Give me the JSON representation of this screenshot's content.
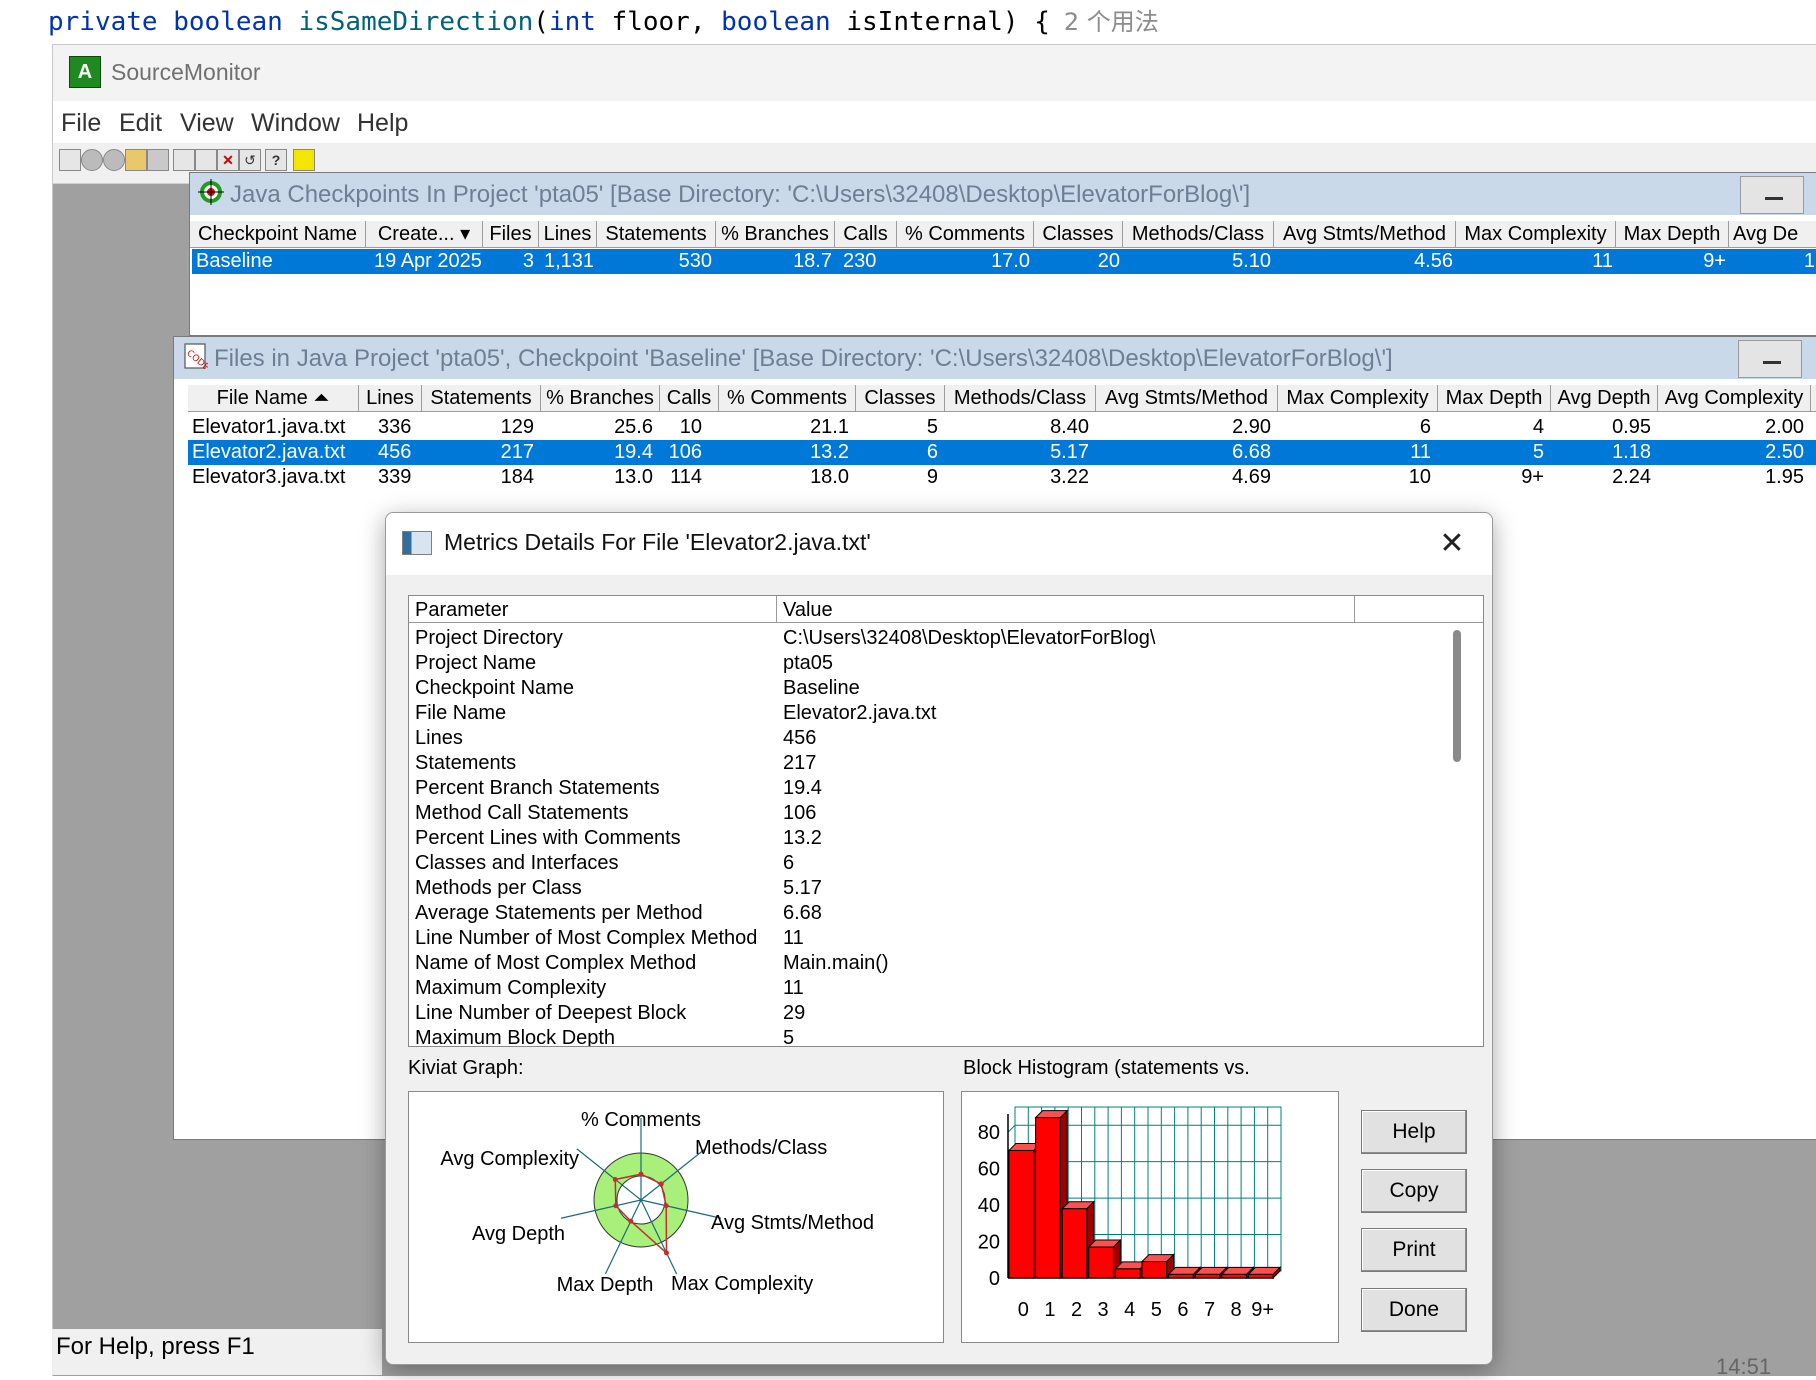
{
  "code": {
    "kw1": "private",
    "kw2": "boolean",
    "method": "isSameDirection",
    "params_open": "(",
    "kw3": "int",
    "param1": " floor, ",
    "kw4": "boolean",
    "param2": " isInternal) {",
    "usage_hint": "2 个用法"
  },
  "app": {
    "title": "SourceMonitor",
    "logo_glyph": "A",
    "menu": [
      "File",
      "Edit",
      "View",
      "Window",
      "Help"
    ],
    "status_text": "For Help, press F1",
    "clock": "14:51"
  },
  "checkpoints_window": {
    "title": "Java Checkpoints In Project 'pta05'  [Base Directory: 'C:\\Users\\32408\\Desktop\\ElevatorForBlog\\']",
    "columns": [
      "Checkpoint Name",
      "Create... ▾",
      "Files",
      "Lines",
      "Statements",
      "% Branches",
      "Calls",
      "% Comments",
      "Classes",
      "Methods/Class",
      "Avg Stmts/Method",
      "Max Complexity",
      "Max Depth",
      "Avg De"
    ],
    "rows": [
      [
        "Baseline",
        "19 Apr 2025",
        "3",
        "1,131",
        "530",
        "18.7",
        "230",
        "17.0",
        "20",
        "5.10",
        "4.56",
        "11",
        "9+",
        "1"
      ]
    ]
  },
  "files_window": {
    "title": "Files in Java Project 'pta05', Checkpoint 'Baseline'  [Base Directory: 'C:\\Users\\32408\\Desktop\\ElevatorForBlog\\']",
    "columns": [
      "File Name ⏶",
      "Lines",
      "Statements",
      "% Branches",
      "Calls",
      "% Comments",
      "Classes",
      "Methods/Class",
      "Avg Stmts/Method",
      "Max Complexity",
      "Max Depth",
      "Avg Depth",
      "Avg Complexity"
    ],
    "rows": [
      [
        "Elevator1.java.txt",
        "336",
        "129",
        "25.6",
        "10",
        "21.1",
        "5",
        "8.40",
        "2.90",
        "6",
        "4",
        "0.95",
        "2.00"
      ],
      [
        "Elevator2.java.txt",
        "456",
        "217",
        "19.4",
        "106",
        "13.2",
        "6",
        "5.17",
        "6.68",
        "11",
        "5",
        "1.18",
        "2.50"
      ],
      [
        "Elevator3.java.txt",
        "339",
        "184",
        "13.0",
        "114",
        "18.0",
        "9",
        "3.22",
        "4.69",
        "10",
        "9+",
        "2.24",
        "1.95"
      ]
    ],
    "selected_row": 1
  },
  "dialog": {
    "title": "Metrics Details For File 'Elevator2.java.txt'",
    "close_glyph": "✕",
    "param_header": "Parameter",
    "value_header": "Value",
    "params": [
      {
        "name": "Project Directory",
        "value": "C:\\Users\\32408\\Desktop\\ElevatorForBlog\\"
      },
      {
        "name": "Project Name",
        "value": "pta05"
      },
      {
        "name": "Checkpoint Name",
        "value": "Baseline"
      },
      {
        "name": "File Name",
        "value": "Elevator2.java.txt"
      },
      {
        "name": "Lines",
        "value": "456"
      },
      {
        "name": "Statements",
        "value": "217"
      },
      {
        "name": "Percent Branch Statements",
        "value": "19.4"
      },
      {
        "name": "Method Call Statements",
        "value": "106"
      },
      {
        "name": "Percent Lines with Comments",
        "value": "13.2"
      },
      {
        "name": "Classes and Interfaces",
        "value": "6"
      },
      {
        "name": "Methods per Class",
        "value": "5.17"
      },
      {
        "name": "Average Statements per Method",
        "value": "6.68"
      },
      {
        "name": "Line Number of Most Complex Method",
        "value": "11"
      },
      {
        "name": "Name of Most Complex Method",
        "value": "Main.main()"
      },
      {
        "name": "Maximum Complexity",
        "value": "11"
      },
      {
        "name": "Line Number of Deepest Block",
        "value": "29"
      },
      {
        "name": "Maximum Block Depth",
        "value": "5"
      }
    ],
    "kiviat_label": "Kiviat Graph:",
    "histogram_label": "Block Histogram (statements vs.",
    "buttons": {
      "help": "Help",
      "copy": "Copy",
      "print": "Print",
      "done": "Done"
    }
  },
  "colors": {
    "selection": "#0078d7",
    "hist_bar": "#ff0000",
    "hist_grid": "#008080",
    "kiviat_band": "#a8f07a",
    "kiviat_line": "#c03030"
  },
  "chart_data": [
    {
      "type": "radar",
      "axes": [
        "% Comments",
        "Methods/Class",
        "Avg Stmts/Method",
        "Max Complexity",
        "Max Depth",
        "Avg Depth",
        "Avg Complexity"
      ],
      "values": [
        0.55,
        0.55,
        0.55,
        1.25,
        0.5,
        0.55,
        0.7
      ]
    },
    {
      "type": "bar",
      "categories": [
        "0",
        "1",
        "2",
        "3",
        "4",
        "5",
        "6",
        "7",
        "8",
        "9+"
      ],
      "values": [
        70,
        88,
        38,
        17,
        5,
        9,
        2,
        2,
        2,
        2
      ],
      "ylim": [
        0,
        90
      ],
      "yticks": [
        "0",
        "20",
        "40",
        "60",
        "80"
      ]
    }
  ]
}
